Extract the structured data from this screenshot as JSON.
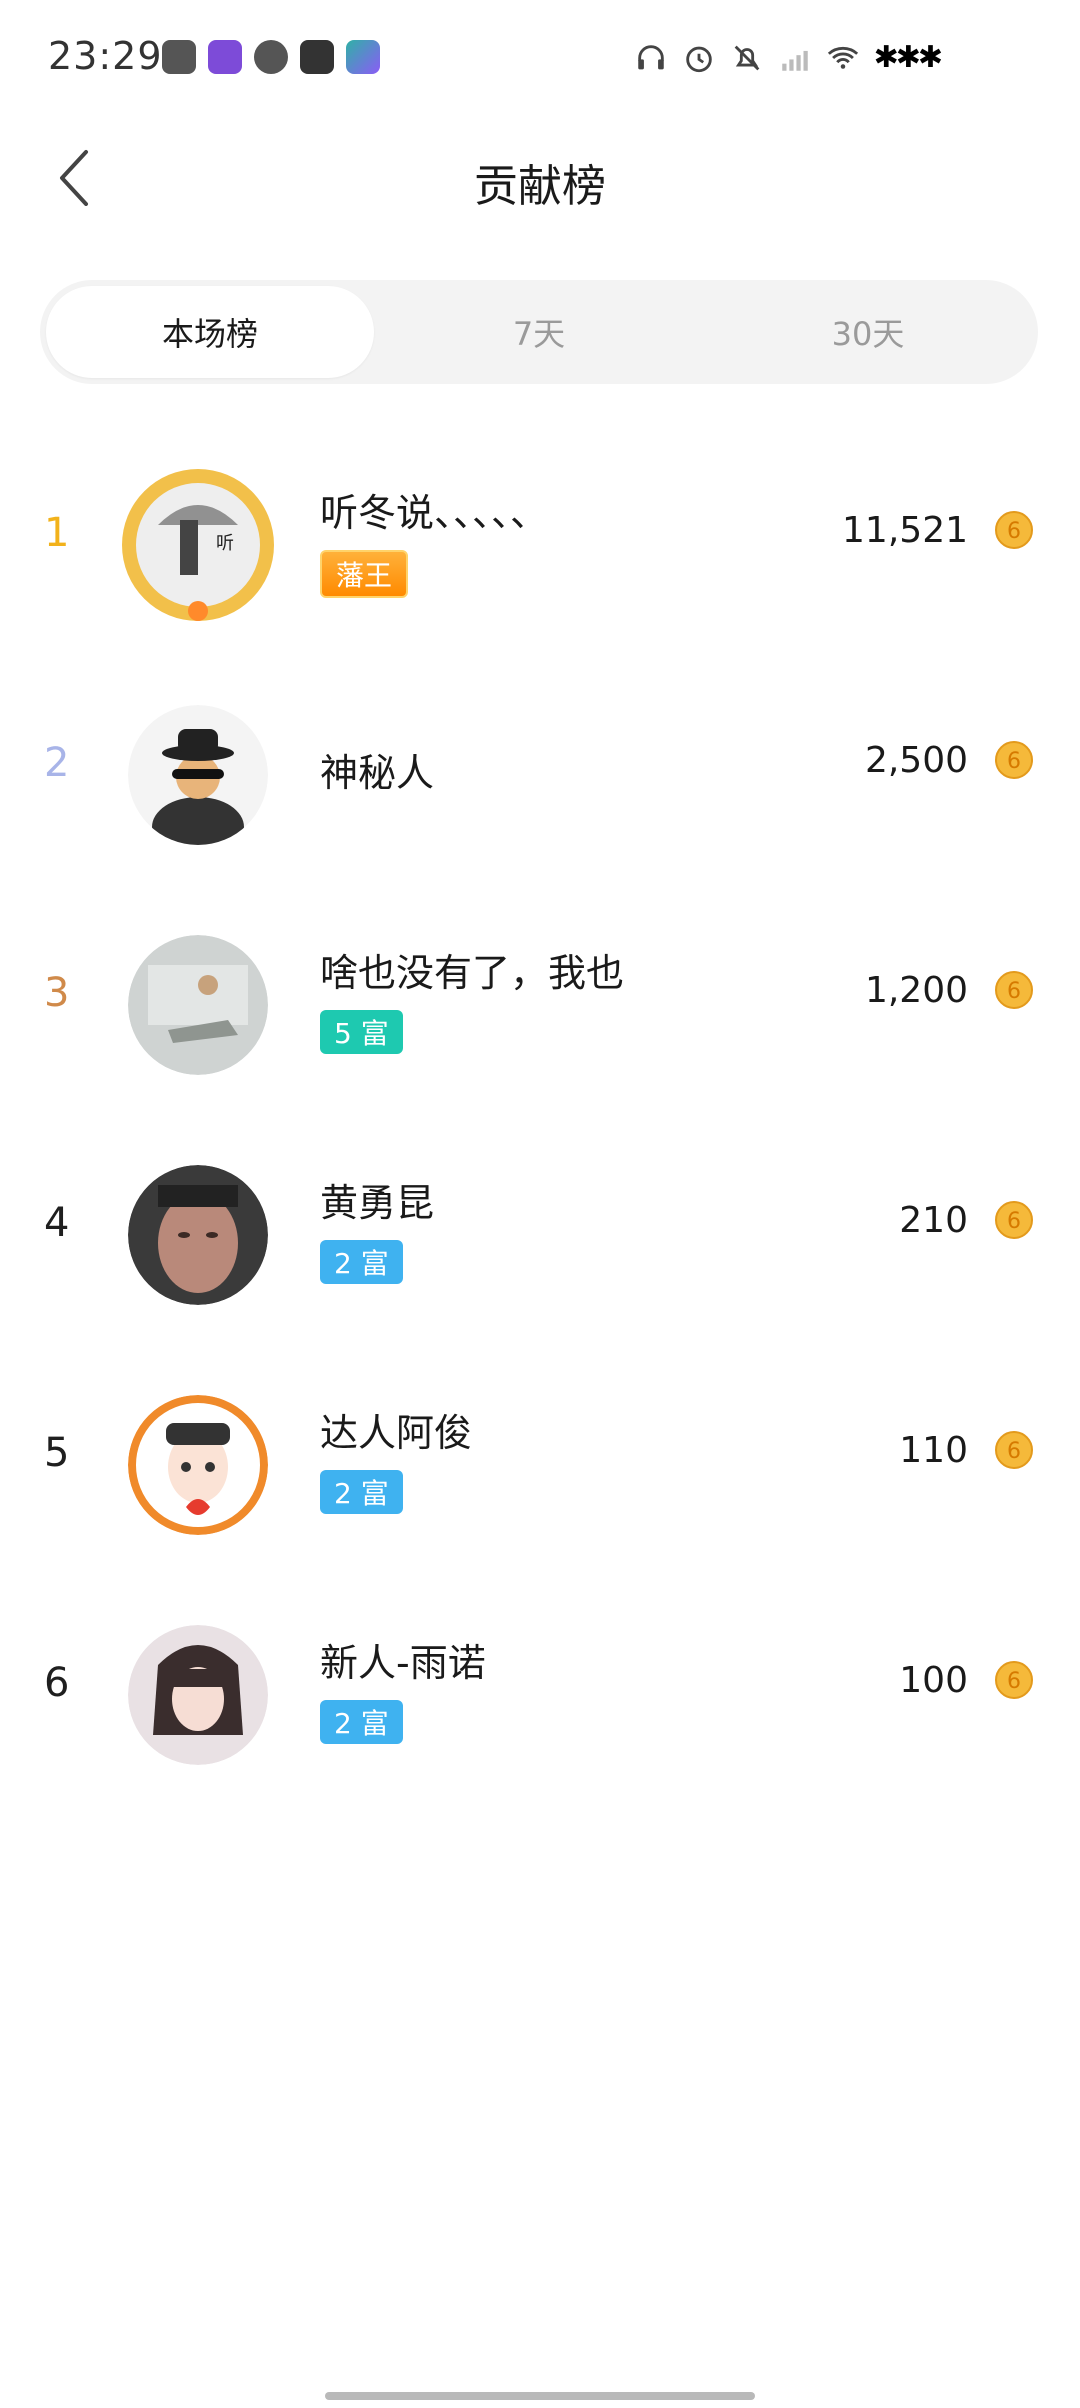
{
  "status": {
    "time": "23:29",
    "signal_text": "✱✱✱"
  },
  "header": {
    "title": "贡献榜",
    "back_icon": "chevron-left-icon"
  },
  "tabs": [
    {
      "label": "本场榜",
      "active": true
    },
    {
      "label": "7天",
      "active": false
    },
    {
      "label": "30天",
      "active": false
    }
  ],
  "ranking": [
    {
      "rank": "1",
      "name": "听冬说、、、、、",
      "badge": "藩王",
      "badge_style": "gold",
      "amount": "11,521",
      "rank_color": "#f2b21b"
    },
    {
      "rank": "2",
      "name": "神秘人",
      "badge": "",
      "badge_style": "",
      "amount": "2,500",
      "rank_color": "#a8b4e8"
    },
    {
      "rank": "3",
      "name": "啥也没有了，我也",
      "badge": "5 富",
      "badge_style": "teal",
      "amount": "1,200",
      "rank_color": "#d08a4a"
    },
    {
      "rank": "4",
      "name": "黄勇昆",
      "badge": "2 富",
      "badge_style": "blue",
      "amount": "210",
      "rank_color": "#1a1a1a"
    },
    {
      "rank": "5",
      "name": "达人阿俊",
      "badge": "2 富",
      "badge_style": "blue",
      "amount": "110",
      "rank_color": "#1a1a1a"
    },
    {
      "rank": "6",
      "name": "新人-雨诺",
      "badge": "2 富",
      "badge_style": "blue",
      "amount": "100",
      "rank_color": "#1a1a1a"
    }
  ],
  "colors": {
    "coin": "#f5b93a",
    "tab_bg": "#f3f3f3"
  }
}
